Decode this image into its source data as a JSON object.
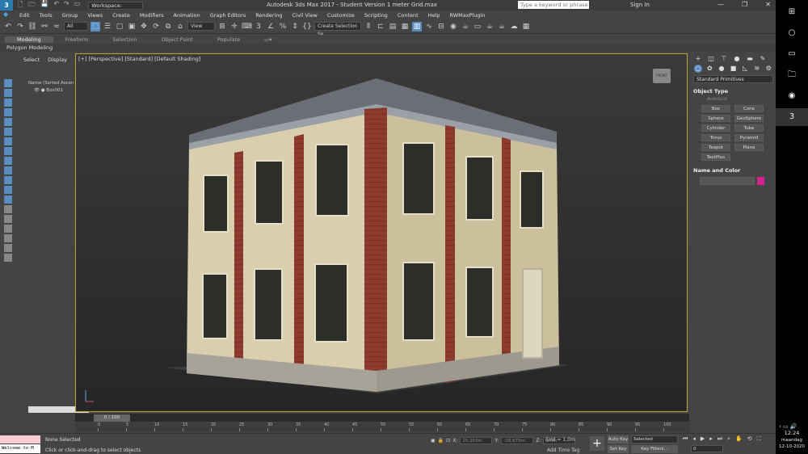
{
  "titlebar": {
    "workspace": "Workspace: Default",
    "window_title": "Autodesk 3ds Max 2017 - Student Version     1 meter Grid.max",
    "search_placeholder": "Type a keyword or phrase",
    "sign_in": "Sign In",
    "minimize": "—",
    "maximize": "❐",
    "close": "✕"
  },
  "menu": [
    "Edit",
    "Tools",
    "Group",
    "Views",
    "Create",
    "Modifiers",
    "Animation",
    "Graph Editors",
    "Rendering",
    "Civil View",
    "Customize",
    "Scripting",
    "Content",
    "Help",
    "RWMaxPlugin"
  ],
  "toolbar": {
    "filter_value": "All",
    "refcoord_value": "View",
    "selection_set_value": "Create Selection Se"
  },
  "ribbon": {
    "tabs": [
      "Modeling",
      "Freeform",
      "Selection",
      "Object Paint",
      "Populate"
    ],
    "active_tab": "Modeling",
    "sub_label": "Polygon Modeling"
  },
  "scene_explorer": {
    "tabs": [
      "Select",
      "Display"
    ],
    "column_header": "Name (Sorted Ascen",
    "items": [
      {
        "name": "Box001"
      }
    ]
  },
  "viewport": {
    "label": "[+] [Perspective] [Standard] [Default Shading]",
    "viewcube_label": "FRONT"
  },
  "command_panel": {
    "category_dropdown": "Standard Primitives",
    "object_type_title": "Object Type",
    "autogrid_label": "AutoGrid",
    "primitives": [
      "Box",
      "Cone",
      "Sphere",
      "GeoSphere",
      "Cylinder",
      "Tube",
      "Torus",
      "Pyramid",
      "Teapot",
      "Plane",
      "TextPlus"
    ],
    "name_color_title": "Name and Color",
    "object_color": "#d6208b"
  },
  "timeline": {
    "slider_label": "0 / 100",
    "ticks": [
      "0",
      "5",
      "10",
      "15",
      "20",
      "25",
      "30",
      "35",
      "40",
      "45",
      "50",
      "55",
      "60",
      "65",
      "70",
      "75",
      "80",
      "85",
      "90",
      "95",
      "100"
    ]
  },
  "status": {
    "maxscript_text": "Welcome to M",
    "selection_status": "None Selected",
    "prompt": "Click or click-and-drag to select objects",
    "x_label": "X:",
    "x_value": "25.163m",
    "y_label": "Y:",
    "y_value": "-28.879m",
    "z_label": "Z:",
    "z_value": "0.0m",
    "grid": "Grid = 1,0m",
    "add_time_tag": "Add Time Tag",
    "auto_key": "Auto Key",
    "set_key": "Set Key",
    "selected_dropdown": "Selected",
    "key_filters": "Key Filters...",
    "frame_value": "0"
  },
  "taskbar": {
    "time": "12:24",
    "day": "maandag",
    "date": "12-10-2020"
  }
}
